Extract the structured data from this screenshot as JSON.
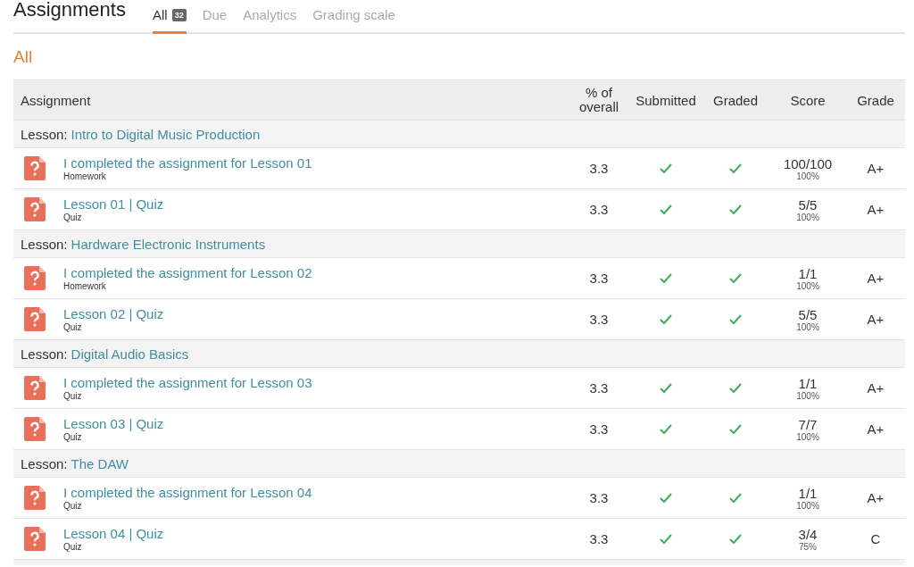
{
  "page_title": "Assignments",
  "tabs": [
    {
      "label": "All",
      "badge": "32",
      "selected": true
    },
    {
      "label": "Due",
      "selected": false
    },
    {
      "label": "Analytics",
      "selected": false
    },
    {
      "label": "Grading scale",
      "selected": false
    }
  ],
  "section_title": "All",
  "table": {
    "columns": [
      "Assignment",
      "% of overall",
      "Submitted",
      "Graded",
      "Score",
      "Grade"
    ],
    "groups": [
      {
        "label": "Lesson:",
        "title": "Intro to Digital Music Production",
        "items": [
          {
            "title": "I completed the assignment for Lesson 01",
            "type": "Homework",
            "percent": "3.3",
            "submitted": true,
            "graded": true,
            "score": "100/100",
            "score_percent": "100%",
            "grade": "A+"
          },
          {
            "title": "Lesson 01 | Quiz",
            "type": "Quiz",
            "percent": "3.3",
            "submitted": true,
            "graded": true,
            "score": "5/5",
            "score_percent": "100%",
            "grade": "A+"
          }
        ]
      },
      {
        "label": "Lesson:",
        "title": "Hardware Electronic Instruments",
        "items": [
          {
            "title": "I completed the assignment for Lesson 02",
            "type": "Homework",
            "percent": "3.3",
            "submitted": true,
            "graded": true,
            "score": "1/1",
            "score_percent": "100%",
            "grade": "A+"
          },
          {
            "title": "Lesson 02 | Quiz",
            "type": "Quiz",
            "percent": "3.3",
            "submitted": true,
            "graded": true,
            "score": "5/5",
            "score_percent": "100%",
            "grade": "A+"
          }
        ]
      },
      {
        "label": "Lesson:",
        "title": "Digital Audio Basics",
        "items": [
          {
            "title": "I completed the assignment for Lesson 03",
            "type": "Quiz",
            "percent": "3.3",
            "submitted": true,
            "graded": true,
            "score": "1/1",
            "score_percent": "100%",
            "grade": "A+"
          },
          {
            "title": "Lesson 03 | Quiz",
            "type": "Quiz",
            "percent": "3.3",
            "submitted": true,
            "graded": true,
            "score": "7/7",
            "score_percent": "100%",
            "grade": "A+"
          }
        ]
      },
      {
        "label": "Lesson:",
        "title": "The DAW",
        "items": [
          {
            "title": "I completed the assignment for Lesson 04",
            "type": "Quiz",
            "percent": "3.3",
            "submitted": true,
            "graded": true,
            "score": "1/1",
            "score_percent": "100%",
            "grade": "A+"
          },
          {
            "title": "Lesson 04 | Quiz",
            "type": "Quiz",
            "percent": "3.3",
            "submitted": true,
            "graded": true,
            "score": "3/4",
            "score_percent": "75%",
            "grade": "C"
          }
        ]
      }
    ]
  }
}
